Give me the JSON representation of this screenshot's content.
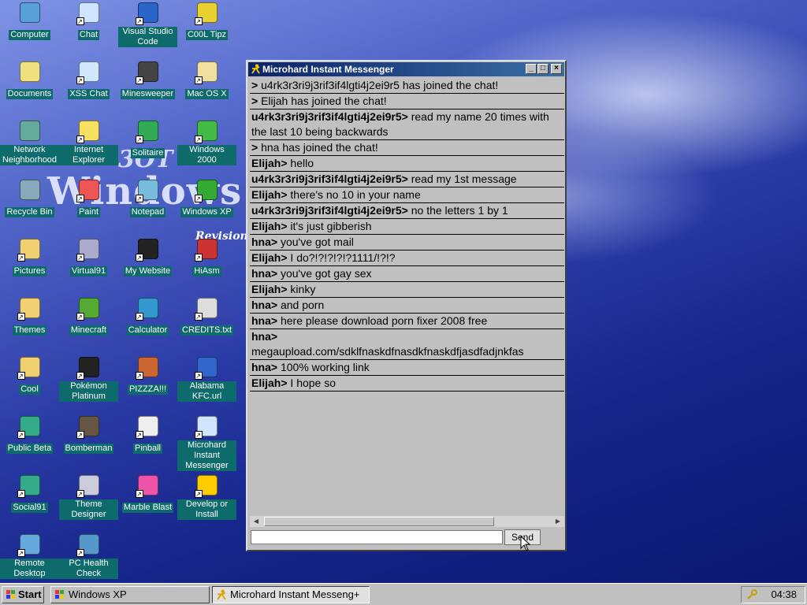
{
  "desktop": {
    "icons": [
      {
        "label": "Computer"
      },
      {
        "label": "Chat"
      },
      {
        "label": "Visual Studio Code"
      },
      {
        "label": "C00L Tipz"
      },
      {
        "label": "Documents"
      },
      {
        "label": "XSS Chat"
      },
      {
        "label": "Minesweeper"
      },
      {
        "label": "Mac OS X"
      },
      {
        "label": "Network Neighborhood"
      },
      {
        "label": "Internet Explorer"
      },
      {
        "label": "Solitaire"
      },
      {
        "label": "Windows 2000"
      },
      {
        "label": "Recycle Bin"
      },
      {
        "label": "Paint"
      },
      {
        "label": "Notepad"
      },
      {
        "label": "Windows XP"
      },
      {
        "label": "Pictures"
      },
      {
        "label": "Virtual91"
      },
      {
        "label": "My Website"
      },
      {
        "label": "HiAsm"
      },
      {
        "label": "Themes"
      },
      {
        "label": "Minecraft"
      },
      {
        "label": "Calculator"
      },
      {
        "label": "CREDITS.txt"
      },
      {
        "label": "Cool"
      },
      {
        "label": "Pokémon Platinum"
      },
      {
        "label": "PIZZZA!!!"
      },
      {
        "label": "Alabama KFC.url"
      },
      {
        "label": "Public Beta"
      },
      {
        "label": "Bomberman"
      },
      {
        "label": "Pinball"
      },
      {
        "label": "Microhard Instant Messenger"
      },
      {
        "label": "Social91"
      },
      {
        "label": "Theme Designer"
      },
      {
        "label": "Marble Blast"
      },
      {
        "label": "Develop or Install"
      },
      {
        "label": "Remote Desktop"
      },
      {
        "label": "PC Health Check"
      }
    ],
    "wallpaper_big": "Windows",
    "wallpaper_small": "3OT",
    "wallpaper_rev": "Revision"
  },
  "messenger": {
    "title": "Microhard Instant Messenger",
    "messages": [
      {
        "sender": ">",
        "text": "u4rk3r3ri9j3rif3if4lgti4j2ei9r5 has joined the chat!"
      },
      {
        "sender": ">",
        "text": "Elijah has joined the chat!"
      },
      {
        "sender": "u4rk3r3ri9j3rif3if4lgti4j2ei9r5>",
        "text": "read my name 20 times with the last 10 being backwards"
      },
      {
        "sender": ">",
        "text": "hna has joined the chat!"
      },
      {
        "sender": "Elijah>",
        "text": "hello"
      },
      {
        "sender": "u4rk3r3ri9j3rif3if4lgti4j2ei9r5>",
        "text": "read my 1st message"
      },
      {
        "sender": "Elijah>",
        "text": "there's no 10 in your name"
      },
      {
        "sender": "u4rk3r3ri9j3rif3if4lgti4j2ei9r5>",
        "text": "no the letters 1 by 1"
      },
      {
        "sender": "Elijah>",
        "text": "it's just gibberish"
      },
      {
        "sender": "hna>",
        "text": "you've got mail"
      },
      {
        "sender": "Elijah>",
        "text": "I do?!?!?!?!?1111/!?!?"
      },
      {
        "sender": "hna>",
        "text": "you've got gay sex"
      },
      {
        "sender": "Elijah>",
        "text": "kinky"
      },
      {
        "sender": "hna>",
        "text": "and porn"
      },
      {
        "sender": "hna>",
        "text": "here please download porn fixer 2008 free"
      },
      {
        "sender": "hna>",
        "text": "megaupload.com/sdklfnaskdfnasdkfnaskdfjasdfadjnkfas"
      },
      {
        "sender": "hna>",
        "text": "100% working link"
      },
      {
        "sender": "Elijah>",
        "text": "I hope so"
      }
    ],
    "input_value": "",
    "send_label": "Send"
  },
  "taskbar": {
    "start_label": "Start",
    "tasks": [
      {
        "label": "Windows XP"
      },
      {
        "label": "Microhard Instant Messeng+"
      }
    ],
    "clock": "04:38"
  }
}
